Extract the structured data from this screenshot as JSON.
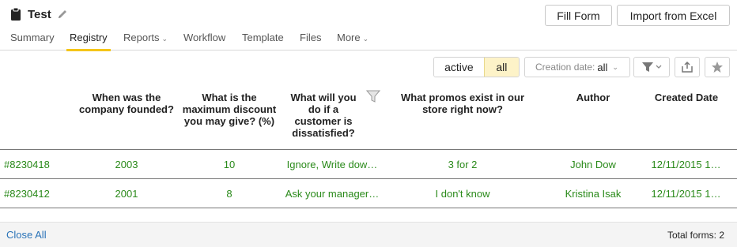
{
  "header": {
    "title": "Test",
    "buttons": {
      "fill_form": "Fill Form",
      "import_excel": "Import from Excel"
    }
  },
  "tabs": [
    {
      "label": "Summary"
    },
    {
      "label": "Registry",
      "active": true
    },
    {
      "label": "Reports",
      "dropdown": true
    },
    {
      "label": "Workflow"
    },
    {
      "label": "Template"
    },
    {
      "label": "Files"
    },
    {
      "label": "More",
      "dropdown": true
    }
  ],
  "toolbar": {
    "toggle_active": "active",
    "toggle_all": "all",
    "selected_toggle": "all",
    "date_label": "Creation date:",
    "date_value": "all"
  },
  "table": {
    "columns": [
      "When was the company founded?",
      "What is the maximum discount you may give? (%)",
      "What will you do if a customer is dissatisfied?",
      "What promos exist in our store right now?",
      "Author",
      "Created Date"
    ],
    "rows": [
      {
        "id": "#8230418",
        "founded": "2003",
        "discount": "10",
        "dissatisfied": "Ignore, Write dow…",
        "promos": "3 for 2",
        "author": "John Dow",
        "created": "12/11/2015 1…"
      },
      {
        "id": "#8230412",
        "founded": "2001",
        "discount": "8",
        "dissatisfied": "Ask your manager…",
        "promos": "I don't know",
        "author": "Kristina Isak",
        "created": "12/11/2015 1…"
      }
    ]
  },
  "footer": {
    "close_all": "Close All",
    "total": "Total forms: 2"
  },
  "colors": {
    "accent": "#f5c518",
    "cell_text": "#2a8a1a",
    "link": "#2a73b8",
    "toggle_selected_bg": "#fdf3c8"
  },
  "icons": [
    "clipboard-icon",
    "pencil-icon",
    "chevron-down-icon",
    "filter-icon",
    "share-icon",
    "star-icon",
    "funnel-icon"
  ]
}
